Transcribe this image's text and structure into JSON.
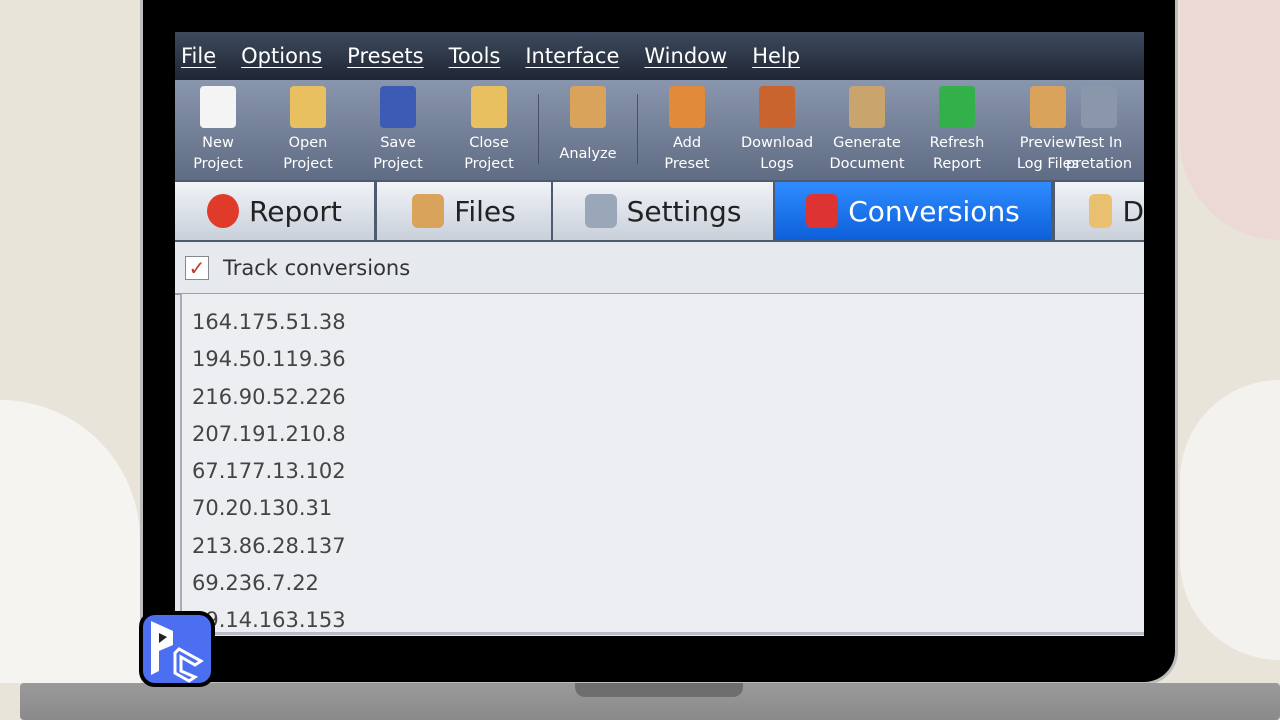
{
  "menu": [
    "File",
    "Options",
    "Presets",
    "Tools",
    "Interface",
    "Window",
    "Help"
  ],
  "toolbar": [
    {
      "label1": "New",
      "label2": "Project",
      "icon": "new-document-icon",
      "color": "#f4f4f4"
    },
    {
      "label1": "Open",
      "label2": "Project",
      "icon": "open-folder-icon",
      "color": "#e8c060"
    },
    {
      "label1": "Save",
      "label2": "Project",
      "icon": "floppy-disk-icon",
      "color": "#3b5bb5"
    },
    {
      "label1": "Close",
      "label2": "Project",
      "icon": "close-folder-icon",
      "color": "#e8c060"
    },
    {
      "label1": "Analyze",
      "label2": "",
      "icon": "scroll-magnifier-icon",
      "color": "#d9a35c"
    },
    {
      "label1": "Add",
      "label2": "Preset",
      "icon": "stamp-icon",
      "color": "#e08a3a"
    },
    {
      "label1": "Download",
      "label2": "Logs",
      "icon": "scroll-download-icon",
      "color": "#c9642e"
    },
    {
      "label1": "Generate",
      "label2": "Document",
      "icon": "scroll-gear-icon",
      "color": "#c9a46c"
    },
    {
      "label1": "Refresh",
      "label2": "Report",
      "icon": "refresh-document-icon",
      "color": "#33b04a"
    },
    {
      "label1": "Preview",
      "label2": "Log Files",
      "icon": "scroll-preview-icon",
      "color": "#d9a35c"
    },
    {
      "label1": "Test In",
      "label2": "pretation",
      "icon": "test-icon",
      "color": "#8a96aa"
    }
  ],
  "tabs": [
    {
      "label": "Report",
      "icon": "pie-chart-icon",
      "color": "#e03a2a"
    },
    {
      "label": "Files",
      "icon": "scroll-icon",
      "color": "#d9a35c"
    },
    {
      "label": "Settings",
      "icon": "gear-icon",
      "color": "#9aa7b8"
    },
    {
      "label": "Conversions",
      "icon": "shopping-cart-icon",
      "color": "#d33"
    },
    {
      "label": "D",
      "icon": "scroll-icon",
      "color": "#e8c070"
    }
  ],
  "track_conversions": {
    "label": "Track conversions",
    "checked": true,
    "mark": "✓"
  },
  "ip_list": [
    "164.175.51.38",
    "194.50.119.36",
    "216.90.52.226",
    "207.191.210.8",
    "67.177.13.102",
    "70.20.130.31",
    "213.86.28.137",
    "69.236.7.22",
    "69.14.163.153"
  ],
  "logo_text": "PC"
}
